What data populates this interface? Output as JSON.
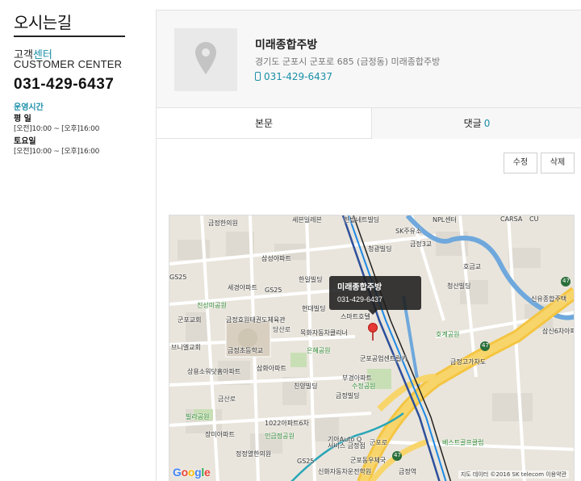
{
  "sidebar": {
    "site_title": "오시는길",
    "cc_kr_prefix": "고객",
    "cc_kr_accent": "센터",
    "cc_en": "CUSTOMER CENTER",
    "phone": "031-429-6437",
    "hours_title": "운영시간",
    "hours": [
      {
        "label": "평    일",
        "value": "[오전]10:00 ~ [오후]16:00"
      },
      {
        "label": "토요일",
        "value": "[오전]10:00 ~ [오후]16:00"
      }
    ]
  },
  "place": {
    "name": "미래종합주방",
    "address": "경기도 군포시 군포로  685 (금정동) 미래종합주방",
    "phone": "031-429-6437",
    "thumbnail_icon": "map-pin-icon"
  },
  "tabs": {
    "body_label": "본문",
    "comments_label": "댓글",
    "comments_count": "0"
  },
  "actions": {
    "edit_label": "수정",
    "delete_label": "삭제"
  },
  "map": {
    "popup_name": "미래종합주방",
    "popup_phone": "031-429-6437",
    "google_g1": "G",
    "google_g2": "o",
    "google_g3": "o",
    "google_g4": "g",
    "google_g5": "l",
    "google_g6": "e",
    "credit": "지도 데이터 ©2016 SK telecom   이용약관",
    "labels": {
      "l1": "금정한의원",
      "l2": "세븐일레븐",
      "l3": "한밭네트빌딩",
      "l4": "SK주유소",
      "l5": "금정3교",
      "l6": "청광빌딩",
      "l7": "삼성아파트",
      "l8": "GS25",
      "l9": "한일빌딩",
      "l10": "세경아파트",
      "l11": "GS25",
      "l12": "진성미공원",
      "l13": "현대빌딩",
      "l14": "스마트호텔",
      "l15": "군포교회",
      "l16": "금정효원태권도체육관",
      "l17": "목화자동차클리너",
      "l18": "금정초등학교",
      "l19": "은혜공원",
      "l20": "브니엘교회",
      "l21": "삼화아파트",
      "l22": "상용소워닷홈아파트",
      "l23": "부경아파트",
      "l24": "수정공원",
      "l25": "친양빌딩",
      "l26": "금정빌딩",
      "l27": "빌라공원",
      "l28": "장미아파트",
      "l29": "1022아파트6차",
      "l30": "인금정공원",
      "l31": "정정열한의원",
      "l32": "기아Auto Q",
      "l33": "서비스 금정점",
      "l34": "군포로",
      "l35": "군포동우체국",
      "l36": "신화자동차운전학원",
      "l37": "금정역",
      "l38": "금정고가차도",
      "l39": "호금교",
      "l40": "청산빌딩",
      "l41": "신유종합주택",
      "l42": "삼신6차아파트",
      "l43": "베스트골프클럽",
      "l44": "CARSA",
      "l45": "CU",
      "l46": "NPL센터",
      "l47": "군포공업센트럴카",
      "l48": "GS25",
      "l49": "47",
      "l50": "47",
      "l51": "47",
      "l52": "금산로",
      "l53": "당산로",
      "l54": "호계공원"
    }
  }
}
